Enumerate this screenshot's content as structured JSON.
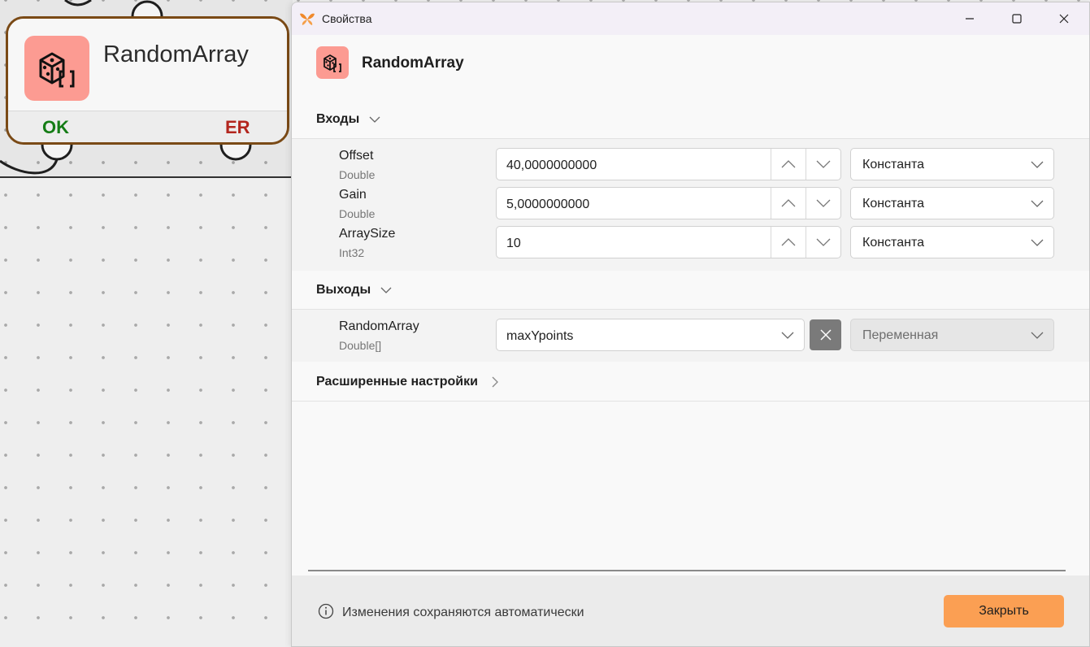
{
  "canvas": {
    "node": {
      "title": "RandomArray",
      "icon": "dice-array-icon",
      "ok_label": "OK",
      "er_label": "ER",
      "colors": {
        "border": "#7a4a16",
        "icon_bg": "#fc9b92",
        "ok": "#157d16",
        "er": "#b3261e"
      }
    }
  },
  "dialog": {
    "window_title": "Свойства",
    "header_title": "RandomArray",
    "inputs": {
      "label": "Входы",
      "items": [
        {
          "name": "Offset",
          "type": "Double",
          "value": "40,0000000000",
          "mode": "Константа"
        },
        {
          "name": "Gain",
          "type": "Double",
          "value": "5,0000000000",
          "mode": "Константа"
        },
        {
          "name": "ArraySize",
          "type": "Int32",
          "value": "10",
          "mode": "Константа"
        }
      ]
    },
    "outputs": {
      "label": "Выходы",
      "items": [
        {
          "name": "RandomArray",
          "type": "Double[]",
          "value": "maxYpoints",
          "mode": "Переменная"
        }
      ]
    },
    "advanced": {
      "label": "Расширенные настройки"
    },
    "footer": {
      "info_text": "Изменения сохраняются автоматически",
      "close_label": "Закрыть"
    },
    "colors": {
      "accent": "#fb9f53",
      "icon_bg": "#fc9b92",
      "logo": "#f08a2c"
    }
  }
}
